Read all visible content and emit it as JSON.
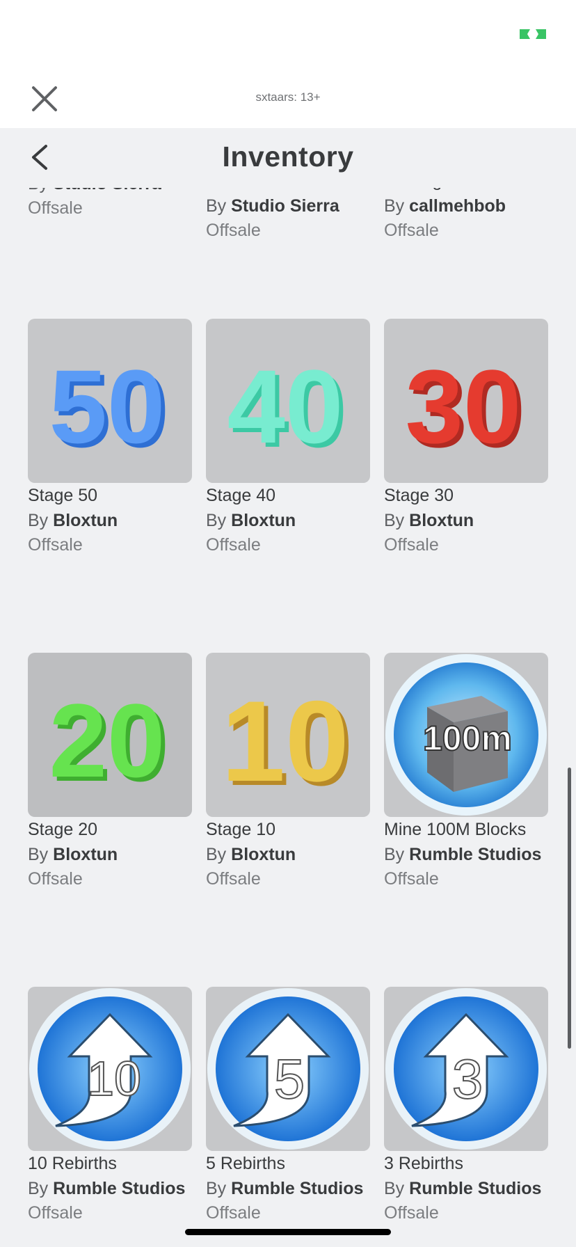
{
  "header": {
    "account_label": "sxtaars: 13+",
    "title": "Inventory"
  },
  "colors": {
    "background": "#f0f1f3",
    "thumb": "#c6c7c9",
    "text": "#393b3d",
    "secondary": "#7b7d80",
    "green": "#39c465"
  },
  "icons": {
    "close": "close-icon",
    "back": "chevron-left-icon",
    "status": "vr-icon"
  },
  "partial_row": [
    {
      "name": "",
      "by": "By",
      "creator": "Studio Sierra",
      "status": "Offsale"
    },
    {
      "name": "",
      "by": "By",
      "creator": "Studio Sierra",
      "status": "Offsale"
    },
    {
      "name": "Package",
      "by": "By",
      "creator": "callmehbob",
      "status": "Offsale"
    }
  ],
  "items": [
    {
      "name": "Stage 50",
      "by": "By",
      "creator": "Bloxtun",
      "status": "Offsale",
      "badge_text": "50",
      "badge_color": "#4a8ff5"
    },
    {
      "name": "Stage 40",
      "by": "By",
      "creator": "Bloxtun",
      "status": "Offsale",
      "badge_text": "40",
      "badge_color": "#6fe6c9"
    },
    {
      "name": "Stage 30",
      "by": "By",
      "creator": "Bloxtun",
      "status": "Offsale",
      "badge_text": "30",
      "badge_color": "#e23a2e"
    },
    {
      "name": "Stage 20",
      "by": "By",
      "creator": "Bloxtun",
      "status": "Offsale",
      "badge_text": "20",
      "badge_color": "#5ee04a"
    },
    {
      "name": "Stage 10",
      "by": "By",
      "creator": "Bloxtun",
      "status": "Offsale",
      "badge_text": "10",
      "badge_color": "#e8c446"
    },
    {
      "name": "Mine 100M Blocks",
      "by": "By",
      "creator": "Rumble Studios",
      "status": "Offsale",
      "badge_text": "100m"
    },
    {
      "name": "10 Rebirths",
      "by": "By",
      "creator": "Rumble Studios",
      "status": "Offsale",
      "badge_text": "10"
    },
    {
      "name": "5 Rebirths",
      "by": "By",
      "creator": "Rumble Studios",
      "status": "Offsale",
      "badge_text": "5"
    },
    {
      "name": "3 Rebirths",
      "by": "By",
      "creator": "Rumble Studios",
      "status": "Offsale",
      "badge_text": "3"
    }
  ]
}
